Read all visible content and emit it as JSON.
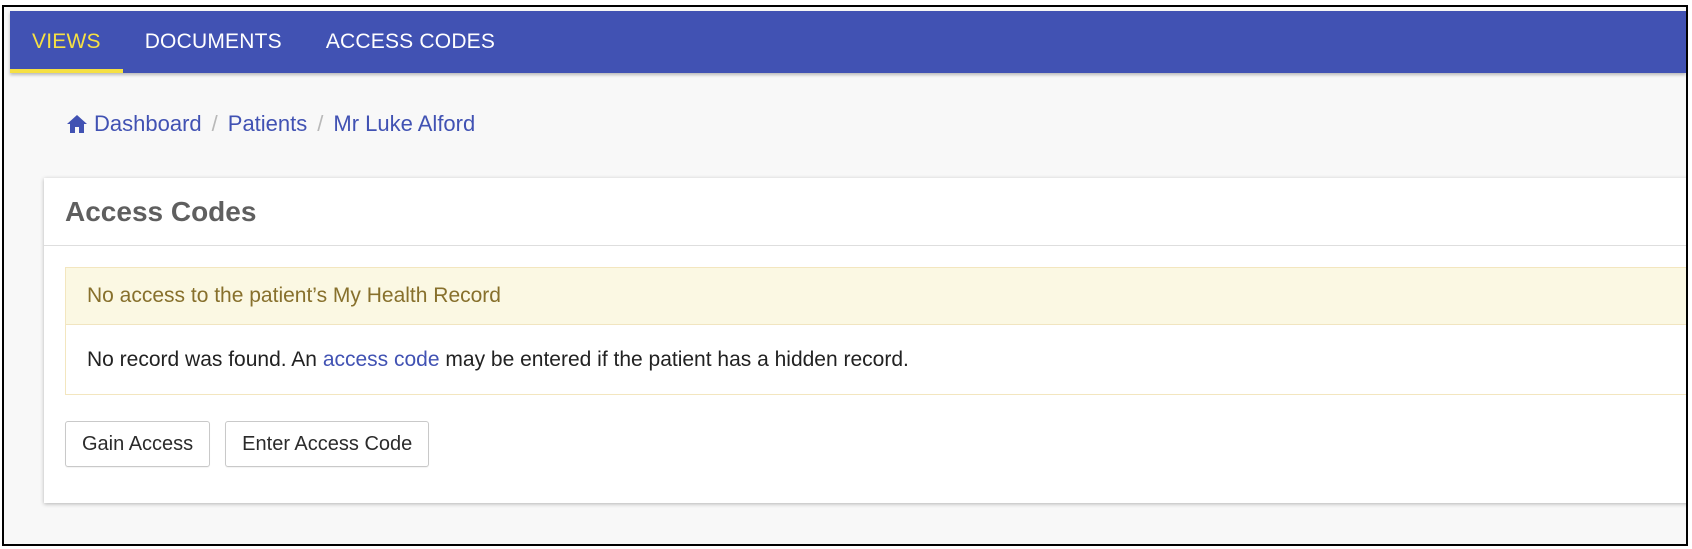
{
  "nav": {
    "tabs": [
      {
        "label": "VIEWS",
        "active": true
      },
      {
        "label": "DOCUMENTS",
        "active": false
      },
      {
        "label": "ACCESS CODES",
        "active": false
      }
    ]
  },
  "breadcrumb": {
    "home_icon": "home-icon",
    "items": [
      "Dashboard",
      "Patients",
      "Mr Luke Alford"
    ],
    "separator": "/"
  },
  "panel": {
    "title": "Access Codes"
  },
  "alert": {
    "heading": "No access to the patient’s My Health Record",
    "body_before": "No record was found. An ",
    "body_link": "access code",
    "body_after": " may be entered if the patient has a hidden record."
  },
  "actions": {
    "gain_access_label": "Gain Access",
    "enter_code_label": "Enter Access Code"
  },
  "colors": {
    "nav_bg": "#4152b3",
    "nav_active": "#f6e043",
    "link": "#4152b3",
    "alert_bg": "#fbf8e3",
    "alert_text": "#87702c"
  }
}
